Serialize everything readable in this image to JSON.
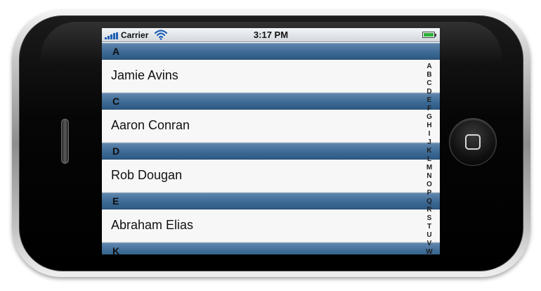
{
  "status_bar": {
    "carrier": "Carrier",
    "time": "3:17 PM",
    "signal_icon": "signal-bars-icon",
    "wifi_icon": "wifi-icon",
    "battery_icon": "battery-icon",
    "battery_level": 1.0,
    "battery_color": "#2db23b"
  },
  "sections": [
    {
      "letter": "A",
      "contacts": [
        "Jamie Avins"
      ]
    },
    {
      "letter": "C",
      "contacts": [
        "Aaron Conran"
      ]
    },
    {
      "letter": "D",
      "contacts": [
        "Rob Dougan"
      ]
    },
    {
      "letter": "E",
      "contacts": [
        "Abraham Elias"
      ]
    },
    {
      "letter": "K",
      "contacts": []
    }
  ],
  "index_letters": [
    "A",
    "B",
    "C",
    "D",
    "E",
    "F",
    "G",
    "H",
    "I",
    "J",
    "K",
    "L",
    "M",
    "N",
    "O",
    "P",
    "Q",
    "R",
    "S",
    "T",
    "U",
    "V",
    "W"
  ],
  "colors": {
    "section_header": "#3d6a95",
    "cell_background": "#f7f7f7"
  }
}
